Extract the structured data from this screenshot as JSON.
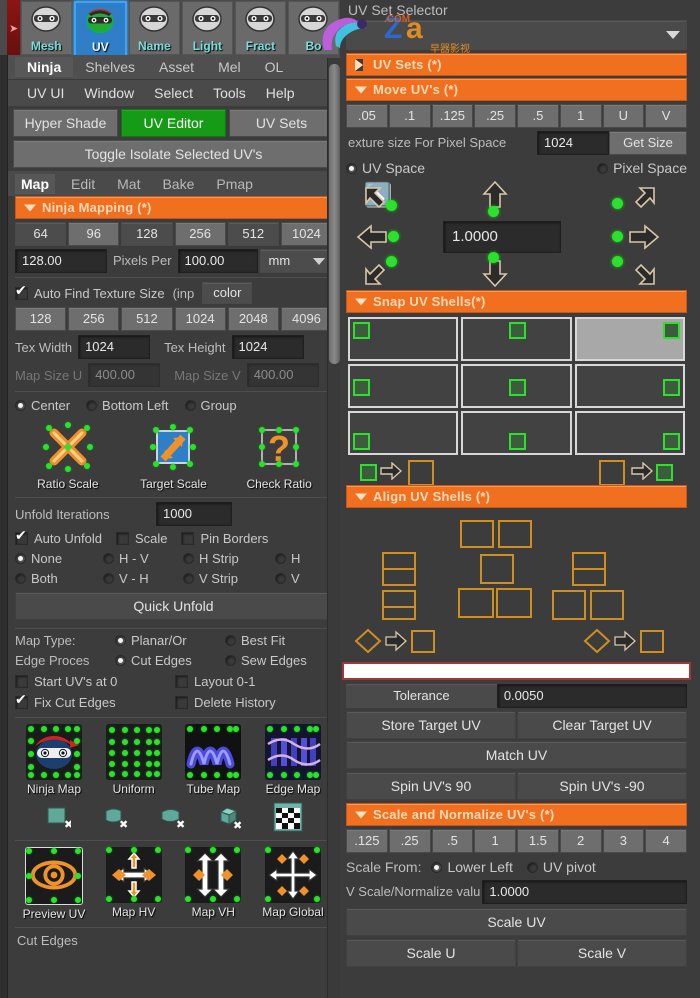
{
  "shelf": {
    "items": [
      {
        "label": "Mesh",
        "icon": "ninja-icon",
        "active": false
      },
      {
        "label": "UV",
        "icon": "ninja-icon",
        "active": true
      },
      {
        "label": "Name",
        "icon": "ninja-icon",
        "active": false
      },
      {
        "label": "Light",
        "icon": "ninja-icon",
        "active": false
      },
      {
        "label": "Fract",
        "icon": "ninja-icon",
        "active": false
      },
      {
        "label": "Bo",
        "icon": "ninja-icon",
        "active": false
      }
    ]
  },
  "left": {
    "top_tabs": [
      {
        "label": "Ninja",
        "active": true
      },
      {
        "label": "Shelves",
        "active": false
      },
      {
        "label": "Asset",
        "active": false
      },
      {
        "label": "Mel",
        "active": false
      },
      {
        "label": "OL",
        "active": false
      }
    ],
    "menu": [
      "UV UI",
      "Window",
      "Select",
      "Tools",
      "Help"
    ],
    "quick_buttons": [
      {
        "label": "Hyper Shade",
        "highlight": false
      },
      {
        "label": "UV Editor",
        "highlight": true
      },
      {
        "label": "UV Sets",
        "highlight": false
      }
    ],
    "toggle_isolate": "Toggle Isolate Selected UV's",
    "sub_tabs": [
      {
        "label": "Map",
        "active": true
      },
      {
        "label": "Edit",
        "active": false
      },
      {
        "label": "Mat",
        "active": false
      },
      {
        "label": "Bake",
        "active": false
      },
      {
        "label": "Pmap",
        "active": false
      }
    ],
    "ninja_mapping": {
      "title": "Ninja Mapping (*)",
      "size_presets": [
        "64",
        "96",
        "128",
        "256",
        "512",
        "1024"
      ],
      "size_presets_state": [
        "dark",
        "light",
        "dark",
        "light",
        "dark",
        "light"
      ],
      "pixels_value": "128.00",
      "pixels_label": "Pixels Per",
      "pixels_per_value": "100.00",
      "unit": "mm",
      "auto_find_label": "Auto Find Texture Size",
      "auto_find_checked": true,
      "inp_label": "(inp",
      "color_value": "color",
      "texture_presets": [
        "128",
        "256",
        "512",
        "1024",
        "2048",
        "4096"
      ],
      "tex_width_label": "Tex Width",
      "tex_width_value": "1024",
      "tex_height_label": "Tex Height",
      "tex_height_value": "1024",
      "map_size_u_label": "Map Size U",
      "map_size_u_value": "400.00",
      "map_size_v_label": "Map Size V",
      "map_size_v_value": "400.00"
    },
    "scale_origin": [
      {
        "label": "Center",
        "selected": true
      },
      {
        "label": "Bottom Left",
        "selected": false
      },
      {
        "label": "Group",
        "selected": false
      }
    ],
    "scale_icons": [
      {
        "label": "Ratio Scale",
        "icon": "ratio-scale-icon"
      },
      {
        "label": "Target Scale",
        "icon": "target-scale-icon"
      },
      {
        "label": "Check Ratio",
        "icon": "check-ratio-icon"
      }
    ],
    "unfold": {
      "iterations_label": "Unfold Iterations",
      "iterations_value": "1000",
      "auto_unfold_label": "Auto Unfold",
      "auto_unfold_checked": true,
      "scale_label": "Scale",
      "scale_checked": false,
      "pin_borders_label": "Pin Borders",
      "pin_borders_checked": false,
      "options_row1": [
        {
          "label": "None",
          "selected": true
        },
        {
          "label": "H - V",
          "selected": false
        },
        {
          "label": "H Strip",
          "selected": false
        },
        {
          "label": "H",
          "selected": false
        }
      ],
      "options_row2": [
        {
          "label": "Both",
          "selected": false
        },
        {
          "label": "V - H",
          "selected": false
        },
        {
          "label": "V Strip",
          "selected": false
        },
        {
          "label": "V",
          "selected": false
        }
      ],
      "quick_unfold": "Quick Unfold"
    },
    "map_options": {
      "map_type_label": "Map Type:",
      "map_type": [
        {
          "label": "Planar/Or",
          "selected": true
        },
        {
          "label": "Best Fit",
          "selected": false
        }
      ],
      "edge_proces_label": "Edge Proces",
      "edge_proces": [
        {
          "label": "Cut Edges",
          "selected": true
        },
        {
          "label": "Sew Edges",
          "selected": false
        }
      ],
      "checks": [
        {
          "label": "Start UV's at 0",
          "checked": false
        },
        {
          "label": "Layout 0-1",
          "checked": false
        },
        {
          "label": "Fix Cut Edges",
          "checked": true
        },
        {
          "label": "Delete History",
          "checked": false
        }
      ]
    },
    "map_icons": [
      {
        "label": "Ninja Map",
        "icon": "ninja-map-icon"
      },
      {
        "label": "Uniform",
        "icon": "uniform-map-icon"
      },
      {
        "label": "Tube Map",
        "icon": "tube-map-icon"
      },
      {
        "label": "Edge Map",
        "icon": "edge-map-icon"
      }
    ],
    "small_icons": [
      {
        "icon": "plane-cut-icon"
      },
      {
        "icon": "cylinder-cut-icon"
      },
      {
        "icon": "curve-cut-icon"
      },
      {
        "icon": "cube-cut-icon"
      },
      {
        "icon": "checker-texture-icon"
      }
    ],
    "preview_icons": [
      {
        "label": "Preview UV",
        "icon": "preview-uv-icon"
      },
      {
        "label": "Map HV",
        "icon": "map-hv-icon"
      },
      {
        "label": "Map VH",
        "icon": "map-vh-icon"
      },
      {
        "label": "Map Global",
        "icon": "map-global-icon"
      }
    ],
    "footer_label": "Cut Edges"
  },
  "right": {
    "uv_set_selector_label": "UV Set Selector",
    "uv_set_dropdown_value": "",
    "uv_sets_section": "UV Sets (*)",
    "move_uvs_section": "Move UV's (*)",
    "move_presets": [
      ".05",
      ".1",
      ".125",
      ".25",
      ".5",
      "1",
      "U",
      "V"
    ],
    "texture_size_label": "exture size For Pixel Space",
    "texture_size_value": "1024",
    "get_size_button": "Get Size",
    "space_options": [
      {
        "label": "UV Space",
        "selected": true
      },
      {
        "label": "Pixel Space",
        "selected": false
      }
    ],
    "move_amount_value": "1.0000",
    "move_arrows": [
      "up-left-arrow-icon",
      "up-arrow-icon",
      "up-right-arrow-icon",
      "left-arrow-icon",
      "right-arrow-icon",
      "down-left-arrow-icon",
      "down-arrow-icon",
      "down-right-arrow-icon"
    ],
    "snap_section": "Snap UV Shells(*)",
    "snap_cells": [
      {
        "name": "snap-top-left",
        "selected": false
      },
      {
        "name": "snap-top-center",
        "selected": false
      },
      {
        "name": "snap-top-right",
        "selected": true
      },
      {
        "name": "snap-middle-left",
        "selected": false
      },
      {
        "name": "snap-middle-center",
        "selected": false
      },
      {
        "name": "snap-middle-right",
        "selected": false
      },
      {
        "name": "snap-bottom-left",
        "selected": false
      },
      {
        "name": "snap-bottom-center",
        "selected": false
      },
      {
        "name": "snap-bottom-right",
        "selected": false
      }
    ],
    "align_section": "Align UV Shells (*)",
    "tolerance_label": "Tolerance",
    "tolerance_value": "0.0050",
    "store_target_uv": "Store Target UV",
    "clear_target_uv": "Clear Target UV",
    "match_uv": "Match UV",
    "spin_90": "Spin UV's 90",
    "spin_minus_90": "Spin UV's -90",
    "scale_section": "Scale and Normalize UV's (*)",
    "scale_presets": [
      ".125",
      ".25",
      ".5",
      "1",
      "1.5",
      "2",
      "3",
      "4"
    ],
    "scale_from_label": "Scale From:",
    "scale_from": [
      {
        "label": "Lower Left",
        "selected": true
      },
      {
        "label": "UV pivot",
        "selected": false
      }
    ],
    "normalize_label": "V Scale/Normalize valu",
    "normalize_value": "1.0000",
    "scale_uv": "Scale UV",
    "scale_u": "Scale U",
    "scale_v": "Scale V"
  },
  "colors": {
    "accent_orange": "#f07020",
    "highlight_green": "#169b16",
    "panel_bg": "#3c3c3c",
    "button_bg": "#5a5a5a",
    "field_bg": "#2b2b2b",
    "marker_green": "#2ee02e",
    "active_blue": "#2f7fc8"
  }
}
